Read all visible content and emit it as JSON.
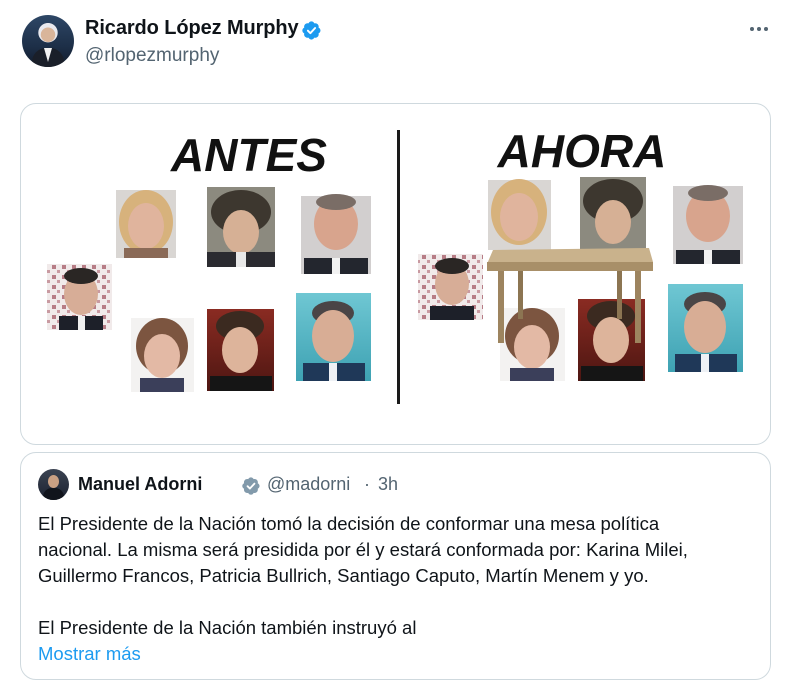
{
  "tweet": {
    "author_name": "Ricardo López Murphy",
    "author_handle": "@rlopezmurphy",
    "verified": true,
    "more_icon": "more-horizontal-icon"
  },
  "image": {
    "left_title": "ANTES",
    "right_title": "AHORA",
    "colors": {
      "title": "#111111",
      "divider": "#1a1a1a",
      "table": "#b7a07d"
    }
  },
  "quote": {
    "author_name": "Manuel Adorni",
    "author_handle": "@madorni",
    "separator": "·",
    "time": "3h",
    "verified_color": "#829aab",
    "lines": [
      "El Presidente de la Nación tomó la decisión de conformar una mesa política",
      "nacional. La misma será presidida por él y estará conformada por: Karina Milei,",
      "Guillermo Francos, Patricia Bullrich, Santiago Caputo, Martín Menem y yo.",
      "El Presidente de la Nación también instruyó al"
    ],
    "show_more": "Mostrar más"
  },
  "colors": {
    "link": "#1d9bf0",
    "verified": "#1d9bf0",
    "secondary_text": "#536471",
    "border": "#cfd9de"
  }
}
